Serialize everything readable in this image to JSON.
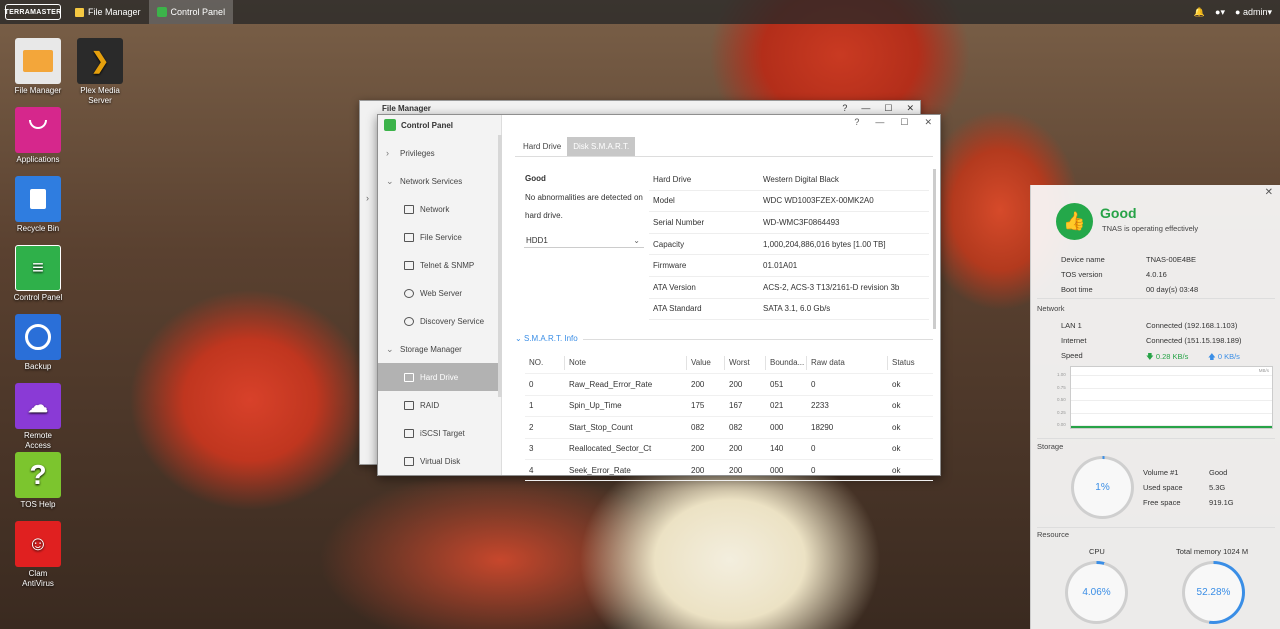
{
  "topbar": {
    "logo": "TERRAMASTER",
    "tabs": [
      {
        "label": "File Manager"
      },
      {
        "label": "Control Panel"
      }
    ],
    "user": "admin"
  },
  "desktop": [
    {
      "label": "File Manager",
      "color": "#e8e8e8"
    },
    {
      "label": "Plex Media Server",
      "color": "#2a2a2a"
    },
    {
      "label": "Applications",
      "color": "#d6278c"
    },
    {
      "label": "Recycle Bin",
      "color": "#2f7de0"
    },
    {
      "label": "Control Panel",
      "color": "#2fb04a"
    },
    {
      "label": "Backup",
      "color": "#2a6fd8"
    },
    {
      "label": "Remote Access",
      "color": "#8a3ad6"
    },
    {
      "label": "TOS Help",
      "color": "#7cc52e"
    },
    {
      "label": "Clam AntiVirus",
      "color": "#e02020"
    }
  ],
  "file_manager": {
    "title": "File Manager"
  },
  "control_panel": {
    "title": "Control Panel",
    "sidebar": [
      {
        "label": "Privileges"
      },
      {
        "label": "Network Services"
      },
      {
        "label": "Network"
      },
      {
        "label": "File Service"
      },
      {
        "label": "Telnet & SNMP"
      },
      {
        "label": "Web Server"
      },
      {
        "label": "Discovery Service"
      },
      {
        "label": "Storage Manager"
      },
      {
        "label": "Hard Drive"
      },
      {
        "label": "RAID"
      },
      {
        "label": "iSCSI Target"
      },
      {
        "label": "Virtual Disk"
      }
    ],
    "tabs": [
      {
        "label": "Hard Drive"
      },
      {
        "label": "Disk S.M.A.R.T."
      }
    ],
    "status_title": "Good",
    "status_desc": "No abnormalities are detected on hard drive.",
    "drive_select": "HDD1",
    "info": [
      {
        "k": "Hard Drive",
        "v": "Western Digital Black"
      },
      {
        "k": "Model",
        "v": "WDC WD1003FZEX-00MK2A0"
      },
      {
        "k": "Serial Number",
        "v": "WD-WMC3F0864493"
      },
      {
        "k": "Capacity",
        "v": "1,000,204,886,016 bytes [1.00 TB]"
      },
      {
        "k": "Firmware",
        "v": "01.01A01"
      },
      {
        "k": "ATA Version",
        "v": "ACS-2, ACS-3 T13/2161-D revision 3b"
      },
      {
        "k": "ATA Standard",
        "v": "SATA 3.1, 6.0 Gb/s"
      }
    ],
    "smart_title": "S.M.A.R.T. Info",
    "smart_headers": [
      "NO.",
      "Note",
      "Value",
      "Worst",
      "Bounda...",
      "Raw data",
      "Status"
    ],
    "smart_rows": [
      [
        "0",
        "Raw_Read_Error_Rate",
        "200",
        "200",
        "051",
        "0",
        "ok"
      ],
      [
        "1",
        "Spin_Up_Time",
        "175",
        "167",
        "021",
        "2233",
        "ok"
      ],
      [
        "2",
        "Start_Stop_Count",
        "082",
        "082",
        "000",
        "18290",
        "ok"
      ],
      [
        "3",
        "Reallocated_Sector_Ct",
        "200",
        "200",
        "140",
        "0",
        "ok"
      ],
      [
        "4",
        "Seek_Error_Rate",
        "200",
        "200",
        "000",
        "0",
        "ok"
      ]
    ]
  },
  "widget": {
    "status": "Good",
    "status_sub": "TNAS is operating effectively",
    "device": [
      {
        "k": "Device name",
        "v": "TNAS-00E4BE"
      },
      {
        "k": "TOS version",
        "v": "4.0.16"
      },
      {
        "k": "Boot time",
        "v": "00 day(s) 03:48"
      }
    ],
    "network_title": "Network",
    "network": [
      {
        "k": "LAN 1",
        "v": "Connected (192.168.1.103)"
      },
      {
        "k": "Internet",
        "v": "Connected (151.15.198.189)"
      }
    ],
    "speed_label": "Speed",
    "speed_down": "0.28 KB/s",
    "speed_up": "0 KB/s",
    "graph_unit": "MB/s",
    "graph_ticks": [
      "1.00",
      "0.75",
      "0.50",
      "0.25",
      "0.00"
    ],
    "storage_title": "Storage",
    "storage_pct": "1%",
    "storage_pct_value": 1,
    "storage": [
      {
        "k": "Volume #1",
        "v": "Good"
      },
      {
        "k": "Used space",
        "v": "5.3G"
      },
      {
        "k": "Free space",
        "v": "919.1G"
      }
    ],
    "resource_title": "Resource",
    "cpu_label": "CPU",
    "cpu_pct": "4.06%",
    "cpu_value": 4.06,
    "mem_label": "Total memory 1024 M",
    "mem_pct": "52.28%",
    "mem_value": 52.28
  }
}
